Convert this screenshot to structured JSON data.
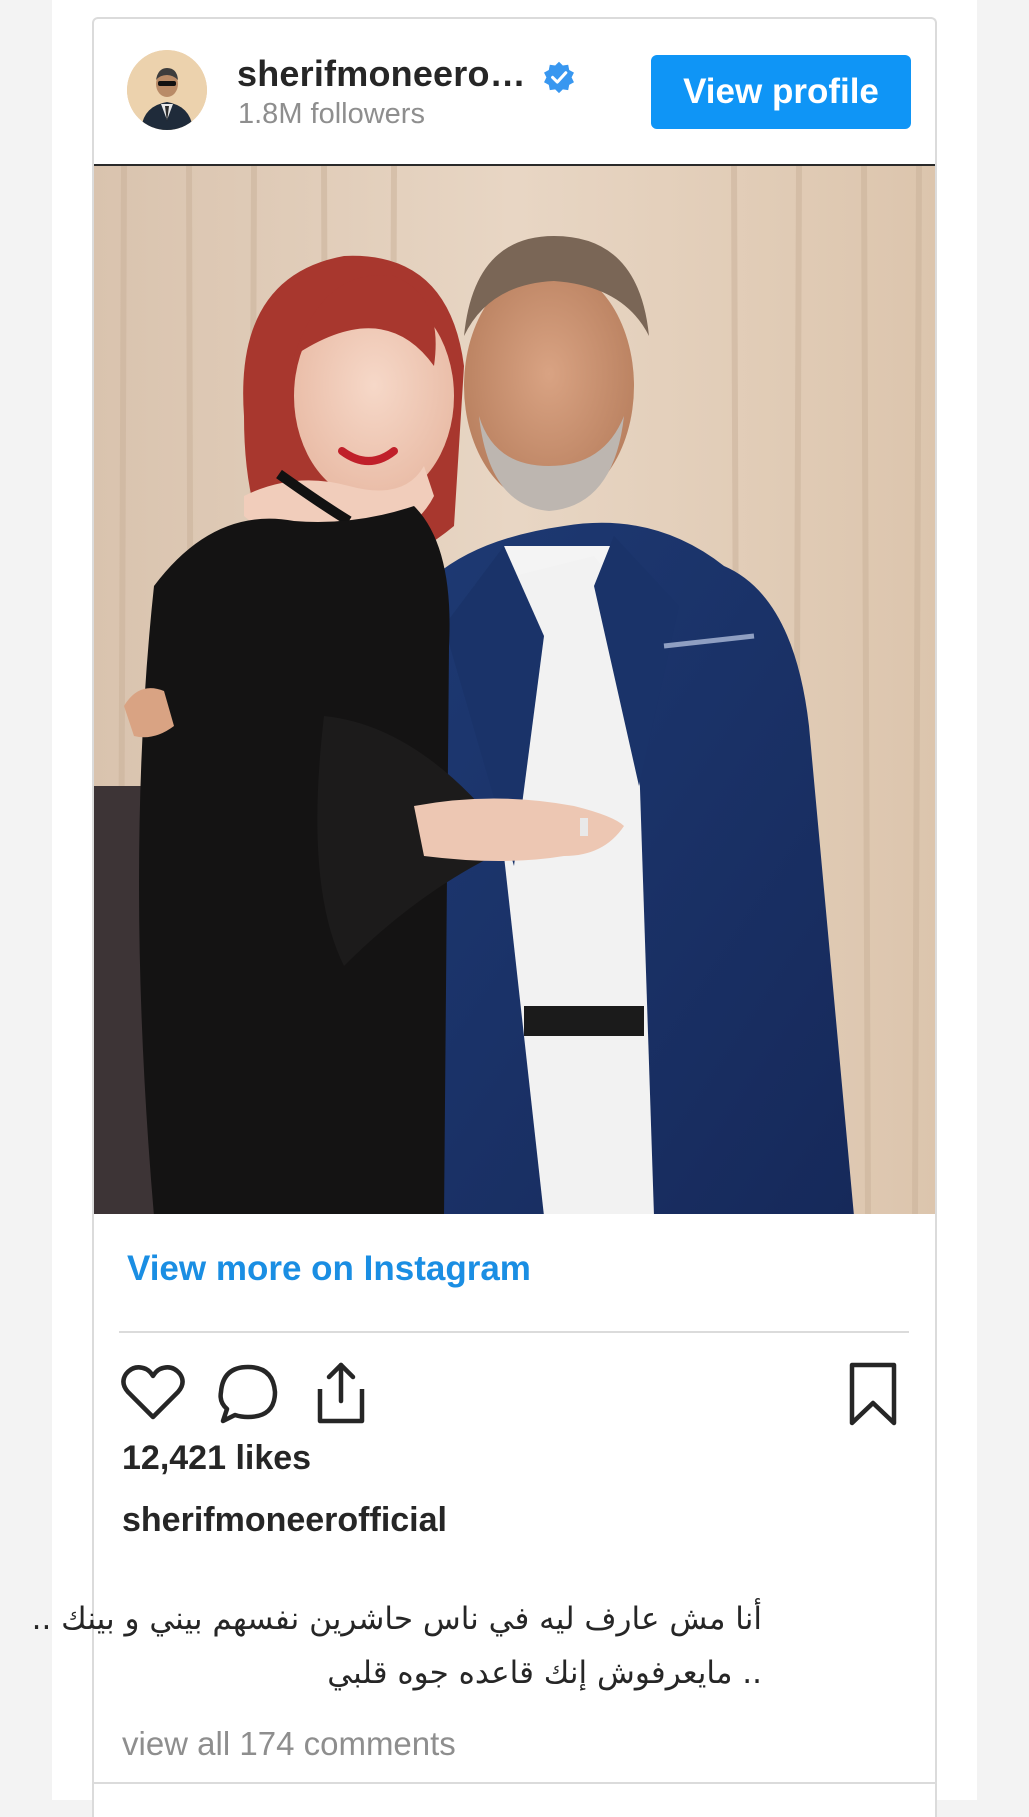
{
  "header": {
    "username": "sherifmoneero…",
    "followers": "1.8M followers",
    "view_profile_label": "View profile",
    "verified_icon": "verified-badge-icon",
    "verified_color": "#3897f0"
  },
  "post": {
    "image_alt": "sherifmoneerofficial post photo"
  },
  "links": {
    "view_more": "View more on Instagram"
  },
  "actions": {
    "like_icon": "heart-icon",
    "comment_icon": "comment-icon",
    "share_icon": "share-icon",
    "save_icon": "bookmark-icon"
  },
  "stats": {
    "likes": "12,421 likes"
  },
  "caption": {
    "username": "sherifmoneerofficial",
    "line1": "أنا مش عارف ليه في ناس حاشرين نفسهم بيني و بينك ..",
    "line2": ".. مايعرفوش إنك قاعده جوه قلبي"
  },
  "comments": {
    "view_all": "view all 174 comments"
  },
  "colors": {
    "accent": "#0f95f6",
    "link": "#1a8ee3",
    "muted": "#8e8e8e",
    "text": "#262626"
  }
}
